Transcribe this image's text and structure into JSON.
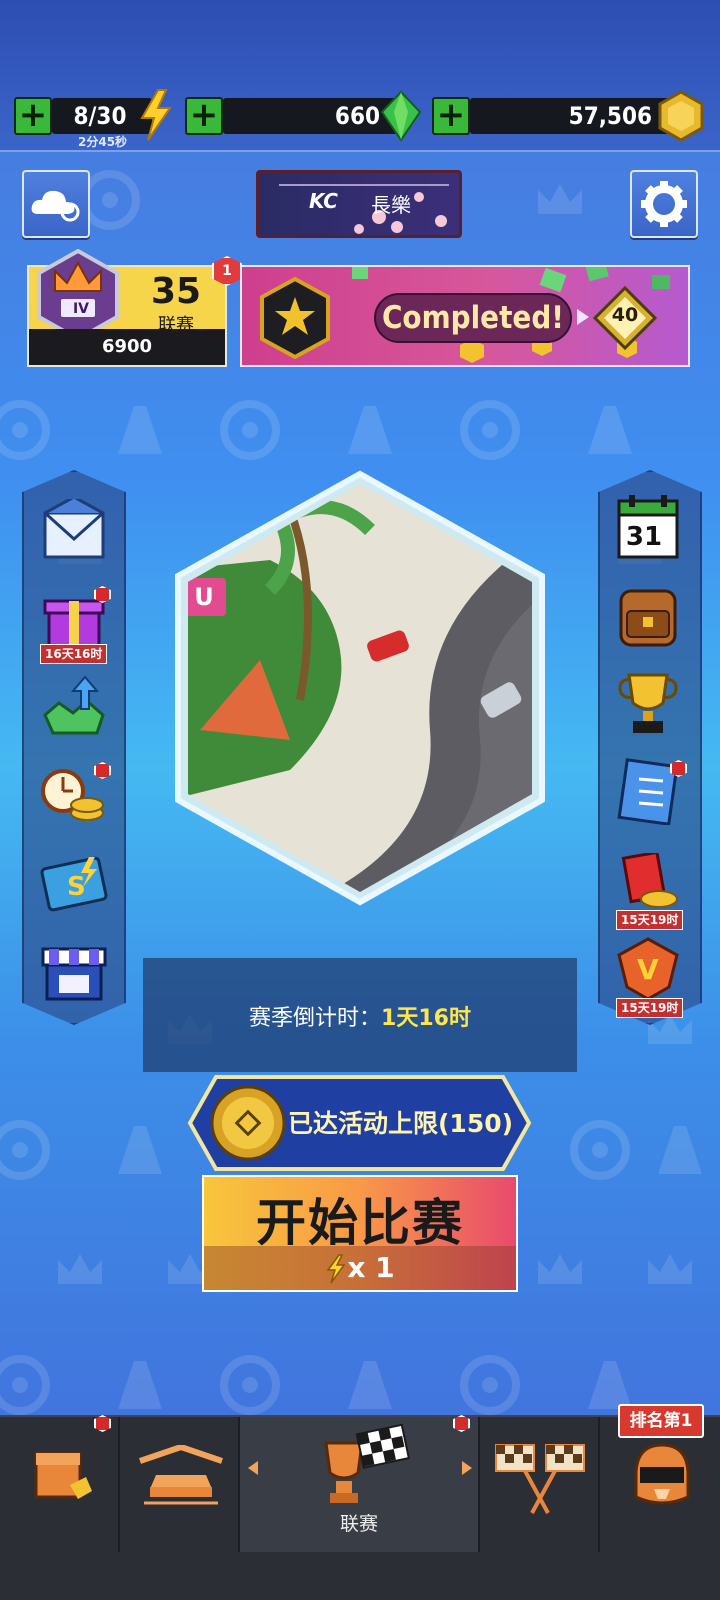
{
  "resources": {
    "energy": {
      "value": "8/30",
      "timer": "2分45秒",
      "icon": "lightning-icon"
    },
    "gems": {
      "value": "660",
      "icon": "green-gem-icon"
    },
    "coins": {
      "value": "57,506",
      "icon": "gold-coin-icon"
    }
  },
  "header": {
    "cloud_icon": "cloud-sync-icon",
    "settings_icon": "gear-icon",
    "banner": {
      "left_text": "KC",
      "right_text": "長樂"
    }
  },
  "league": {
    "rank_roman": "IV",
    "level": "35",
    "label": "联赛",
    "points": "6900",
    "notification": "1"
  },
  "event": {
    "status": "Completed!",
    "reward": "40"
  },
  "left_menu": [
    {
      "icon": "mail-icon"
    },
    {
      "icon": "gift-icon",
      "timer": "16天16时"
    },
    {
      "icon": "gem-upgrade-icon"
    },
    {
      "icon": "time-coins-icon"
    },
    {
      "icon": "season-pass-icon"
    },
    {
      "icon": "shop-icon"
    }
  ],
  "right_menu": [
    {
      "icon": "calendar-icon",
      "date": "31"
    },
    {
      "icon": "backpack-icon"
    },
    {
      "icon": "trophy-icon"
    },
    {
      "icon": "checklist-icon"
    },
    {
      "icon": "red-envelope-icon",
      "timer": "15天19时"
    },
    {
      "icon": "vip-icon",
      "timer": "15天19时"
    }
  ],
  "track_badge": "U",
  "countdown": {
    "label": "赛季倒计时：",
    "value": "1天16时"
  },
  "limit_text": "已达活动上限(150)",
  "start": {
    "label": "开始比赛",
    "cost": "x 1"
  },
  "bottom_nav": {
    "items": [
      {
        "icon": "garage-box-icon"
      },
      {
        "icon": "car-garage-icon"
      },
      {
        "icon": "league-trophy-icon",
        "label": "联赛"
      },
      {
        "icon": "checkered-flags-icon"
      },
      {
        "icon": "helmet-icon"
      }
    ],
    "rank_badge": "排名第1"
  },
  "colors": {
    "accent_green": "#3ab83a",
    "badge_red": "#d8392f",
    "highlight_yellow": "#ffe64a"
  }
}
